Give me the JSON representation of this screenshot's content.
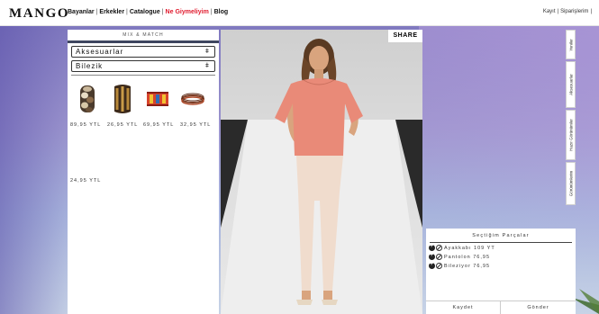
{
  "header": {
    "logo": "MANGO",
    "nav": [
      "Bayanlar",
      "Erkekler",
      "Catalogue",
      "Ne Giymeliyim",
      "Blog"
    ],
    "nav_highlight": "Ne Giymeliyim",
    "links": [
      "Kayıt",
      "Siparişlerim"
    ],
    "separator": "|"
  },
  "mix_match": {
    "title": "MIX & MATCH",
    "category_select": "Aksesuarlar",
    "subcategory_select": "Bilezik",
    "caret": "ǂ",
    "products": [
      {
        "icon": "beaded-bracelet-icon",
        "price": "89,95 YTL"
      },
      {
        "icon": "wood-cuff-icon",
        "price": "26,95 YTL"
      },
      {
        "icon": "embroidered-cuff-icon",
        "price": "69,95 YTL"
      },
      {
        "icon": "thin-bangles-icon",
        "price": "32,95 YTL"
      },
      {
        "icon": "",
        "price": "24,95 YTL"
      }
    ]
  },
  "model": {
    "share_label": "SHARE"
  },
  "side_tabs": [
    "Yeniler",
    "Aksesuarlar",
    "Hazır Görünümler",
    "Görünümlerim"
  ],
  "selected": {
    "title": "Seçtiğim Parçalar",
    "items": [
      "Ayakkabı 109 YT",
      "Pantolon 76,95",
      "Bileziyor 76,95"
    ],
    "save_label": "Kaydet",
    "send_label": "Gönder"
  },
  "colors": {
    "highlight": "#e0192c",
    "panel_rule": "#3f4660",
    "blouse": "#e98a78",
    "trousers": "#f0dccd"
  }
}
